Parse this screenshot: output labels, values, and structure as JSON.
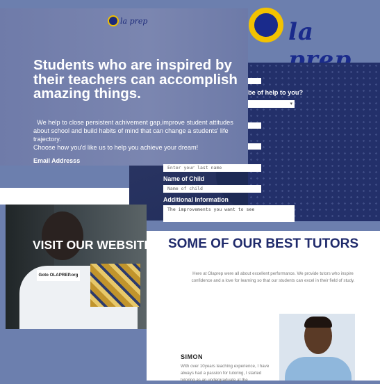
{
  "brand": {
    "small_logo": "la prep",
    "big_logo": "la prep"
  },
  "hero": {
    "title": "Students who are inspired by their teachers can accomplish amazing things.",
    "subtitle_line1": "We help to close persistent achivement gap,improve student attitudes about school and build habits of mind that can change a students' life trajectory.",
    "subtitle_line2": "Choose how you'd like us to help you achieve your dream!",
    "email_label": "Email Addresss"
  },
  "form": {
    "question": "be of help to you?",
    "select_caret": "▾",
    "last_name_placeholder": "Enter your last name",
    "child_label": "Name of Child",
    "child_placeholder": "Name of child",
    "additional_label": "Additional Information",
    "additional_placeholder": "The improvements you want to see"
  },
  "visit": {
    "title": "VISIT OUR WEBSITE TODAY",
    "button": "Goto OLAPREP.org"
  },
  "tutors": {
    "title": "SOME OF OUR BEST TUTORS",
    "description": "Here at Olaprep were all about excellent performance. We provide tutors who inspire confidence and a love for learning so that our students can excel in their field of study.",
    "name": "SIMON",
    "bio": "With over 10years teaching experience, I have always had a passion for tutoring, I started tutoring as an undergraduate at the"
  }
}
